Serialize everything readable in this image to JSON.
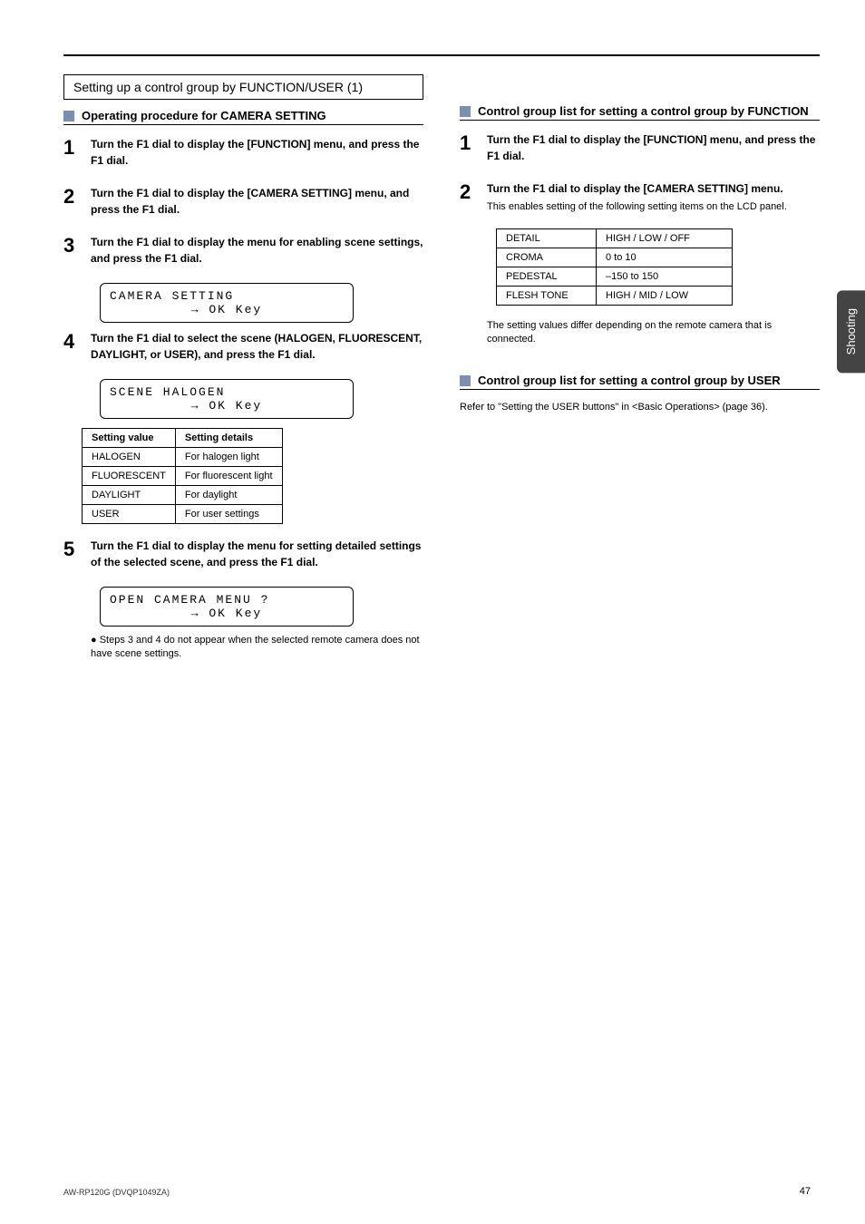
{
  "sideTab": "Shooting",
  "pageNum": "47",
  "footer": "AW-RP120G (DVQP1049ZA)",
  "leftCol": {
    "boxedHeading": "Setting up a control group by FUNCTION/USER (1)",
    "section": {
      "title": "Operating procedure for CAMERA SETTING"
    },
    "steps": [
      {
        "num": "1",
        "main": "Turn the F1 dial to display the [FUNCTION] menu, and press the F1 dial.",
        "detail": ""
      },
      {
        "num": "2",
        "main": "Turn the F1 dial to display the [CAMERA SETTING] menu, and press the F1 dial.",
        "detail": ""
      },
      {
        "num": "3",
        "main": "Turn the F1 dial to display the menu for enabling scene settings, and press the F1 dial.",
        "lcd": {
          "line1": "CAMERA SETTING",
          "line2": "→ OK Key"
        }
      },
      {
        "num": "4",
        "main": "Turn the F1 dial to select the scene (HALOGEN, FLUORESCENT, DAYLIGHT, or USER), and press the F1 dial.",
        "lcd": {
          "line1": "SCENE        HALOGEN",
          "line2": "→ OK Key"
        }
      },
      {
        "num": "5",
        "main": "Turn the F1 dial to display the menu for setting detailed settings of the selected scene, and press the F1 dial.",
        "lcd": {
          "line1": "OPEN CAMERA MENU ?",
          "line2": "→ OK Key"
        }
      }
    ],
    "sceneTable": {
      "headers": [
        "Setting value",
        "Setting details"
      ],
      "rows": [
        [
          "HALOGEN",
          "For halogen light"
        ],
        [
          "FLUORESCENT",
          "For fluorescent light"
        ],
        [
          "DAYLIGHT",
          "For daylight"
        ],
        [
          "USER",
          "For user settings"
        ]
      ]
    },
    "note": "● Steps 3 and 4 do not appear when the selected remote camera does not have scene settings."
  },
  "rightCol": {
    "section": {
      "title": "Control group list for setting a control group by FUNCTION"
    },
    "steps": [
      {
        "num": "1",
        "main": "Turn the F1 dial to display the [FUNCTION] menu, and press the F1 dial.",
        "detail": ""
      },
      {
        "num": "2",
        "main": "Turn the F1 dial to display the [CAMERA SETTING] menu.",
        "detail": "This enables setting of the following setting items on the LCD panel."
      }
    ],
    "settingTable": {
      "rows": [
        [
          "DETAIL",
          "HIGH / LOW / OFF"
        ],
        [
          "CROMA",
          "0 to 10"
        ],
        [
          "PEDESTAL",
          "–150 to 150"
        ],
        [
          "FLESH TONE",
          "HIGH / MID / LOW"
        ]
      ]
    },
    "tableNote": "The setting values differ depending on the remote camera that is connected.",
    "section2": {
      "title": "Control group list for setting a control group by USER"
    },
    "userNote": "Refer to \"Setting the USER buttons\" in <Basic Operations> (page 36)."
  }
}
